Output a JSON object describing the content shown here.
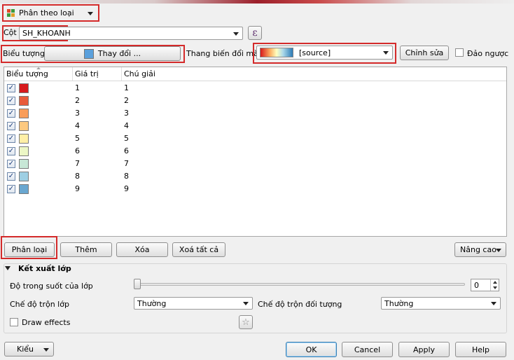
{
  "renderer": {
    "label": "Phân theo loại",
    "icon": "categorized-renderer-icon"
  },
  "column": {
    "label": "Cột",
    "value": "SH_KHOANH",
    "expression_icon": "expression-icon"
  },
  "symbol": {
    "label": "Biểu tượng",
    "change_button": "Thay đổi ...",
    "swatch_color": "#5aa0dc"
  },
  "color_ramp": {
    "label": "Thang biến đổi màu",
    "value": "[source]",
    "edit_button": "Chỉnh sửa",
    "invert_label": "Đảo ngược",
    "invert_checked": false
  },
  "table": {
    "headers": [
      "Biểu tượng",
      "Giá trị",
      "Chú giải"
    ],
    "rows": [
      {
        "checked": true,
        "color": "#d7191c",
        "value": "1",
        "legend": "1"
      },
      {
        "checked": true,
        "color": "#e85b3a",
        "value": "2",
        "legend": "2"
      },
      {
        "checked": true,
        "color": "#f99d59",
        "value": "3",
        "legend": "3"
      },
      {
        "checked": true,
        "color": "#fdc980",
        "value": "4",
        "legend": "4"
      },
      {
        "checked": true,
        "color": "#ffefa6",
        "value": "5",
        "legend": "5"
      },
      {
        "checked": true,
        "color": "#ecf7c5",
        "value": "6",
        "legend": "6"
      },
      {
        "checked": true,
        "color": "#c7e7d6",
        "value": "7",
        "legend": "7"
      },
      {
        "checked": true,
        "color": "#9ecfe3",
        "value": "8",
        "legend": "8"
      },
      {
        "checked": true,
        "color": "#6aa7d0",
        "value": "9",
        "legend": "9"
      }
    ]
  },
  "actions": {
    "classify": "Phân loại",
    "add": "Thêm",
    "delete": "Xóa",
    "delete_all": "Xoá tất cả",
    "advanced": "Nâng cao"
  },
  "layer_rendering": {
    "title": "Kết xuất lớp",
    "opacity_label": "Độ trong suốt của lớp",
    "opacity_value": "0",
    "layer_blend_label": "Chế độ trộn lớp",
    "layer_blend_value": "Thường",
    "feature_blend_label": "Chế độ trộn đối tượng",
    "feature_blend_value": "Thường",
    "draw_effects_label": "Draw effects",
    "draw_effects_checked": false,
    "effects_icon": "star-effects-icon"
  },
  "footer": {
    "style": "Kiểu",
    "ok": "OK",
    "cancel": "Cancel",
    "apply": "Apply",
    "help": "Help"
  }
}
